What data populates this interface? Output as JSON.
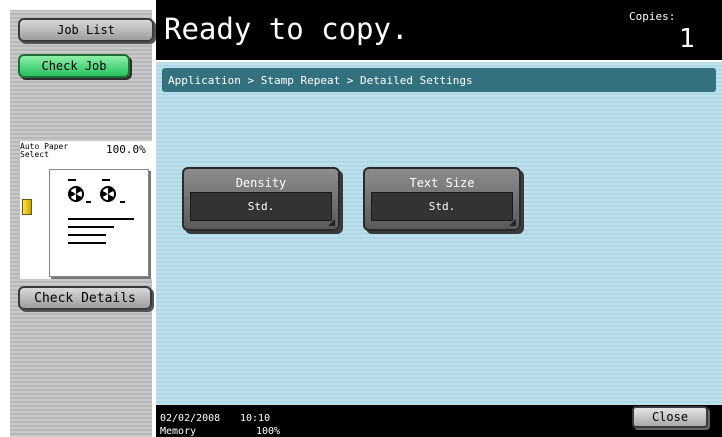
{
  "sidebar": {
    "job_list_label": "Job List",
    "check_job_label": "Check Job",
    "paper_select_label": "Auto Paper Select",
    "zoom": "100.0%",
    "check_details_label": "Check Details"
  },
  "header": {
    "status": "Ready to copy.",
    "copies_label": "Copies:",
    "copies_value": "1"
  },
  "breadcrumb": "Application > Stamp Repeat > Detailed Settings",
  "settings": [
    {
      "label": "Density",
      "value": "Std."
    },
    {
      "label": "Text Size",
      "value": "Std."
    }
  ],
  "footer": {
    "date": "02/02/2008",
    "time": "10:10",
    "memory_label": "Memory",
    "memory_value": "100%",
    "close_label": "Close"
  },
  "colors": {
    "accent_green": "#28c060",
    "breadcrumb_bg": "#33717e",
    "main_bg": "#bde1ec"
  }
}
